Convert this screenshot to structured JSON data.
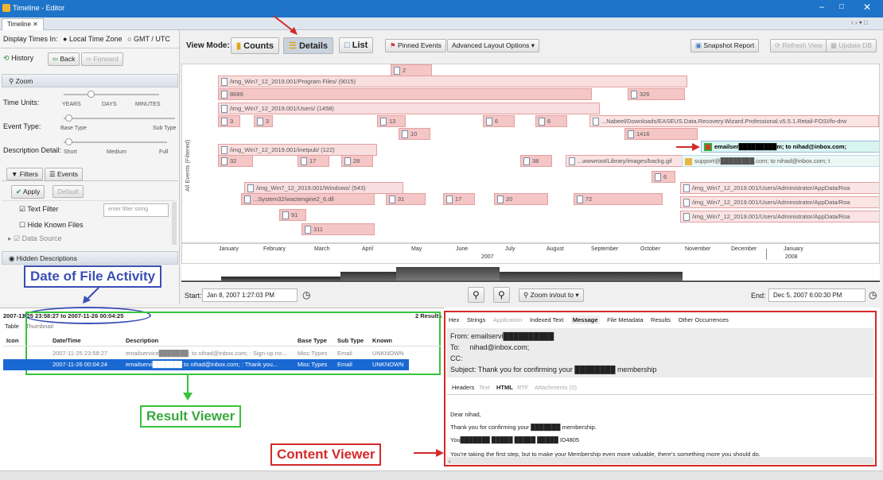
{
  "window": {
    "title": "Timeline - Editor",
    "tab": "Timeline"
  },
  "left_panel": {
    "display_times_label": "Display Times In:",
    "local_tz": "Local Time Zone",
    "gmt": "GMT / UTC",
    "history": "History",
    "back": "Back",
    "forward": "Forward",
    "zoom_header": "Zoom",
    "time_units_label": "Time Units:",
    "time_units_ticks": [
      "YEARS",
      "DAYS",
      "MINUTES"
    ],
    "event_type_label": "Event Type:",
    "event_type_ticks": [
      "Base Type",
      "Sub Type"
    ],
    "desc_detail_label": "Description Detail:",
    "desc_detail_ticks": [
      "Short",
      "Medium",
      "Full"
    ],
    "filters_tab": "Filters",
    "events_tab": "Events",
    "apply": "Apply",
    "default": "Default",
    "text_filter": "Text Filter",
    "text_filter_placeholder": "enter filter string",
    "hide_known": "Hide Known Files",
    "data_source": "Data Source",
    "hidden_desc": "Hidden Descriptions"
  },
  "toolbar": {
    "view_mode_label": "View Mode:",
    "counts": "Counts",
    "details": "Details",
    "list": "List",
    "pinned": "Pinned Events",
    "advanced": "Advanced Layout Options",
    "snapshot": "Snapshot Report",
    "refresh": "Refresh View",
    "update_db": "Update DB"
  },
  "timeline": {
    "y_label": "All Events (Filtered)",
    "groups": [
      {
        "label": "/img_Win7_12_2019.001/Program Files/  (9015)"
      },
      {
        "label": "/img_Win7_12_2019.001/Users/  (1458)"
      },
      {
        "label": "/img_Win7_12_2019.001/inetpub/  (122)"
      },
      {
        "label": "/img_Win7_12_2019.001/Windows/  (543)"
      }
    ],
    "counts": [
      "2",
      "8689",
      "326",
      "3",
      "3",
      "13",
      "10",
      "6",
      "6",
      "1416",
      "32",
      "17",
      "28",
      "38",
      "6",
      "31",
      "17",
      "20",
      "72",
      "91",
      "311"
    ],
    "paths": [
      "...Nabeel/Downloads/EASEUS.Data.Recovery.Wizard.Professional.v5.5.1.Retail-FOSI/fo-drw",
      "...wwwroot/Library/images/backg.gif",
      "...System32/wactengine2_6.dll",
      "/img_Win7_12_2019.001/Users/Administrator/AppData/Roa"
    ],
    "email1": "emailser█████████m; to nihad@inbox.com;",
    "email2": "support@████████.com; to nihad@inbox.com; t",
    "months": [
      "January",
      "February",
      "March",
      "April",
      "May",
      "June",
      "July",
      "August",
      "September",
      "October",
      "November",
      "December",
      "January"
    ],
    "year": "2007",
    "year2": "2008"
  },
  "timebar": {
    "start_label": "Start:",
    "start": "Jan 8, 2007 1:27:03 PM",
    "zoom": "Zoom in/out to",
    "end_label": "End:",
    "end": "Dec 5, 2007 6:00:30 PM"
  },
  "results": {
    "range": "2007-11-25 23:58:27 to 2007-11-26 00:04:25",
    "count": "2 Results",
    "tabs": [
      "Table",
      "Thumbnail"
    ],
    "headers": [
      "Icon",
      "Date/Time",
      "Description",
      "Base Type",
      "Sub Type",
      "Known"
    ],
    "rows": [
      {
        "datetime": "2007-11-25 23:58:27",
        "desc": "emailservice███████; to nihad@inbox.com; : Sign-up no...",
        "base": "Misc Types",
        "sub": "Email",
        "known": "UNKNOWN"
      },
      {
        "datetime": "2007-11-26 00:04:24",
        "desc": "emailservi███████ to nihad@inbox.com; : Thank you...",
        "base": "Misc Types",
        "sub": "Email",
        "known": "UNKNOWN"
      }
    ]
  },
  "content": {
    "tabs": [
      "Hex",
      "Strings",
      "Application",
      "Indexed Text",
      "Message",
      "File Metadata",
      "Results",
      "Other Occurrences"
    ],
    "from_label": "From:",
    "from": "emailservi██████████",
    "to_label": "To:",
    "to": "nihad@inbox.com;",
    "cc_label": "CC:",
    "subject_label": "Subject:",
    "subject": "Thank you for confirming your ████████ membership",
    "sub_tabs": [
      "Headers",
      "Text",
      "HTML",
      "RTF",
      "Attachments (0)"
    ],
    "body": [
      "Dear nihad,",
      "Thank you for confirming your ███████ membership.",
      "You███████ █████ █████ █████ ID4805",
      "You're taking the first step, but to make your Membership even more valuable, there's something more you should do."
    ]
  },
  "annotations": {
    "date_activity": "Date of File Activity",
    "result_viewer": "Result Viewer",
    "content_viewer": "Content Viewer"
  }
}
